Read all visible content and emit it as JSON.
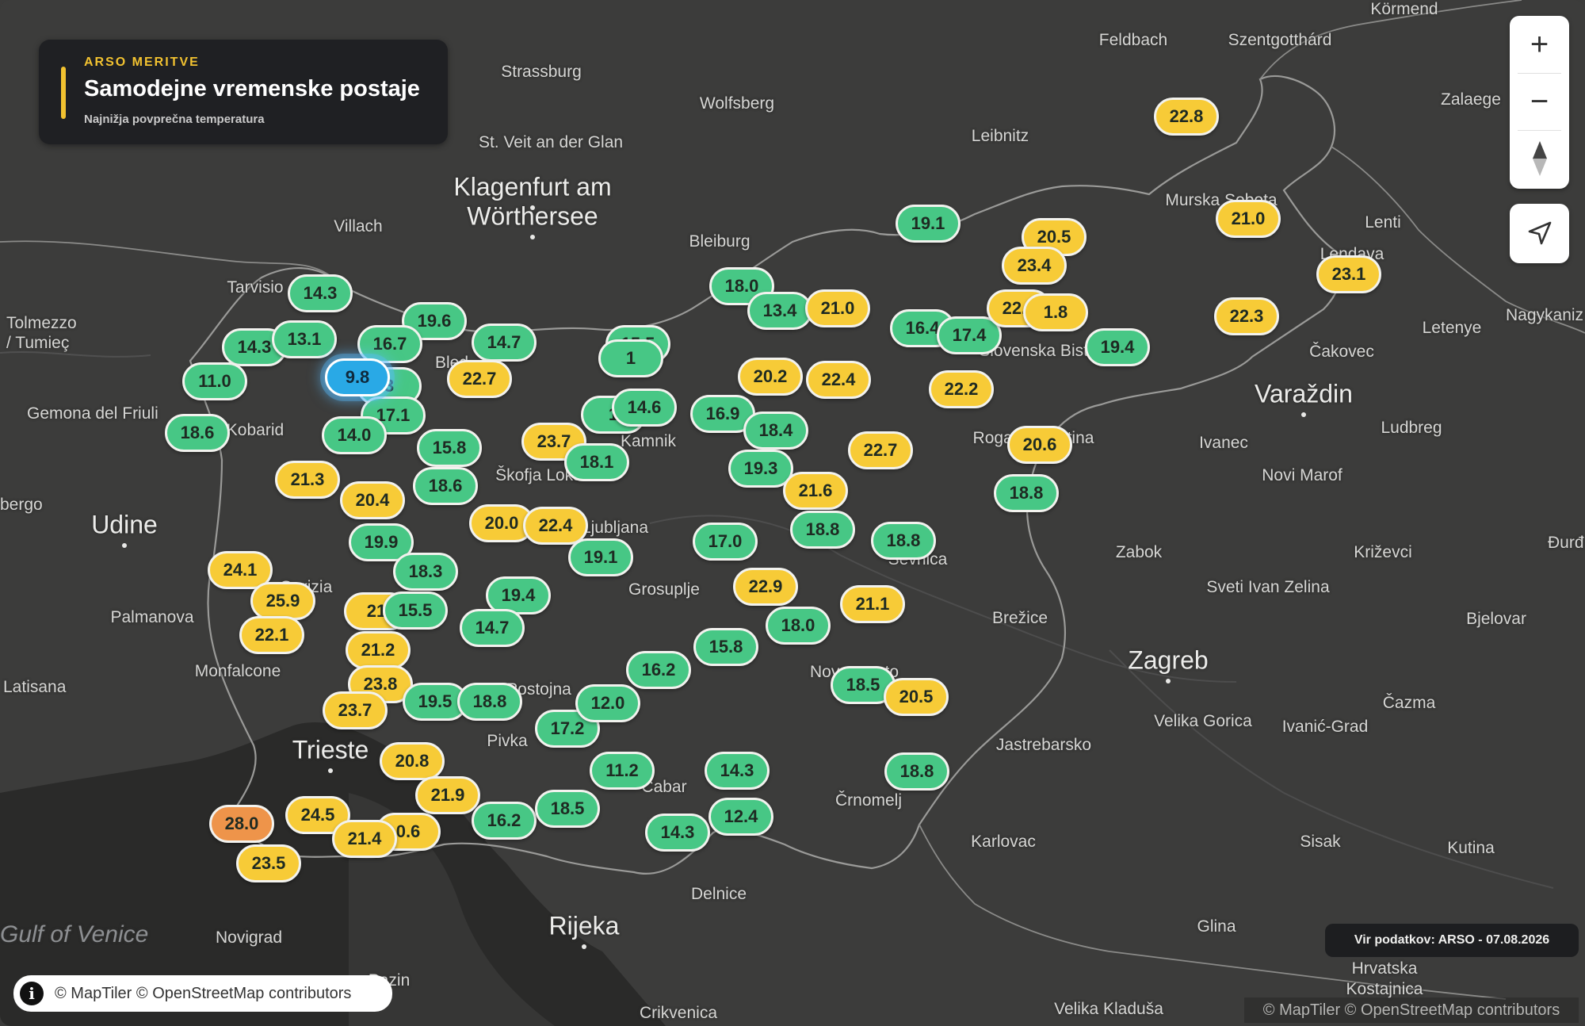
{
  "header": {
    "kicker": "ARSO MERITVE",
    "title": "Samodejne vremenske postaje",
    "subtitle": "Najnižja povprečna temperatura",
    "accent": "#f2c230"
  },
  "controls": {
    "zoom_in": "+",
    "zoom_out": "−",
    "compass": "compass-icon",
    "locate": "locate-arrow-icon"
  },
  "attribution": {
    "info_icon": "info-icon",
    "text": "© MapTiler © OpenStreetMap contributors",
    "text_corner": "© MapTiler © OpenStreetMap contributors"
  },
  "source_label": "Vir podatkov: ARSO - 07.08.2026",
  "marker_colors": {
    "green": "#47c785",
    "yellow": "#f7cb37",
    "orange": "#ee944a",
    "blue_min": "#29a9e6"
  },
  "markers": [
    {
      "value": "14.3",
      "color": "g"
    },
    {
      "value": "14.3",
      "color": "g"
    },
    {
      "value": "13.1",
      "color": "g"
    },
    {
      "value": "19.6",
      "color": "g"
    },
    {
      "value": "16.7",
      "color": "g"
    },
    {
      "value": "11.0",
      "color": "g"
    },
    {
      "value": "3",
      "color": "g"
    },
    {
      "value": "17.1",
      "color": "g"
    },
    {
      "value": "9.8",
      "color": "b"
    },
    {
      "value": "14.7",
      "color": "g"
    },
    {
      "value": "22.7",
      "color": "y"
    },
    {
      "value": "18.6",
      "color": "g"
    },
    {
      "value": "14.0",
      "color": "g"
    },
    {
      "value": "15.8",
      "color": "g"
    },
    {
      "value": "18.6",
      "color": "g"
    },
    {
      "value": "21.3",
      "color": "y"
    },
    {
      "value": "20.4",
      "color": "y"
    },
    {
      "value": "19.9",
      "color": "g"
    },
    {
      "value": "24.1",
      "color": "y"
    },
    {
      "value": "18.3",
      "color": "g"
    },
    {
      "value": "25.9",
      "color": "y"
    },
    {
      "value": "22.1",
      "color": "y"
    },
    {
      "value": "21",
      "color": "y"
    },
    {
      "value": "15.5",
      "color": "g"
    },
    {
      "value": "21.2",
      "color": "y"
    },
    {
      "value": "23.8",
      "color": "y"
    },
    {
      "value": "23.7",
      "color": "y"
    },
    {
      "value": "19.5",
      "color": "g"
    },
    {
      "value": "18.8",
      "color": "g"
    },
    {
      "value": "20.8",
      "color": "y"
    },
    {
      "value": "21.9",
      "color": "y"
    },
    {
      "value": "24.5",
      "color": "y"
    },
    {
      "value": "28.0",
      "color": "o"
    },
    {
      "value": "0.6",
      "color": "y"
    },
    {
      "value": "21.4",
      "color": "y"
    },
    {
      "value": "23.5",
      "color": "y"
    },
    {
      "value": "16.2",
      "color": "g"
    },
    {
      "value": "18.5",
      "color": "g"
    },
    {
      "value": "11.2",
      "color": "g"
    },
    {
      "value": "14.3",
      "color": "g"
    },
    {
      "value": "14.3",
      "color": "g"
    },
    {
      "value": "12.4",
      "color": "g"
    },
    {
      "value": "17.2",
      "color": "g"
    },
    {
      "value": "12.0",
      "color": "g"
    },
    {
      "value": "16.2",
      "color": "g"
    },
    {
      "value": "15.8",
      "color": "g"
    },
    {
      "value": "19.4",
      "color": "g"
    },
    {
      "value": "14.7",
      "color": "g"
    },
    {
      "value": "20.0",
      "color": "y"
    },
    {
      "value": "22.4",
      "color": "y"
    },
    {
      "value": "19.1",
      "color": "g"
    },
    {
      "value": "23.7",
      "color": "y"
    },
    {
      "value": "18.1",
      "color": "g"
    },
    {
      "value": "1",
      "color": "g"
    },
    {
      "value": "15.5",
      "color": "g"
    },
    {
      "value": "1",
      "color": "g"
    },
    {
      "value": "14.6",
      "color": "g"
    },
    {
      "value": "18.0",
      "color": "g"
    },
    {
      "value": "13.4",
      "color": "g"
    },
    {
      "value": "21.0",
      "color": "y"
    },
    {
      "value": "16.9",
      "color": "g"
    },
    {
      "value": "18.4",
      "color": "g"
    },
    {
      "value": "20.2",
      "color": "y"
    },
    {
      "value": "22.4",
      "color": "y"
    },
    {
      "value": "19.3",
      "color": "g"
    },
    {
      "value": "21.6",
      "color": "y"
    },
    {
      "value": "18.8",
      "color": "g"
    },
    {
      "value": "22.7",
      "color": "y"
    },
    {
      "value": "18.8",
      "color": "g"
    },
    {
      "value": "17.0",
      "color": "g"
    },
    {
      "value": "22.9",
      "color": "y"
    },
    {
      "value": "18.0",
      "color": "g"
    },
    {
      "value": "21.1",
      "color": "y"
    },
    {
      "value": "18.5",
      "color": "g"
    },
    {
      "value": "20.5",
      "color": "y"
    },
    {
      "value": "18.8",
      "color": "g"
    },
    {
      "value": "19.1",
      "color": "g"
    },
    {
      "value": "16.4",
      "color": "g"
    },
    {
      "value": "17.4",
      "color": "g"
    },
    {
      "value": "22.7",
      "color": "y"
    },
    {
      "value": "1.8",
      "color": "y"
    },
    {
      "value": "19.4",
      "color": "g"
    },
    {
      "value": "22.2",
      "color": "y"
    },
    {
      "value": "20.6",
      "color": "y"
    },
    {
      "value": "18.8",
      "color": "g"
    },
    {
      "value": "20.5",
      "color": "y"
    },
    {
      "value": "23.4",
      "color": "y"
    },
    {
      "value": "22.8",
      "color": "y"
    },
    {
      "value": "21.0",
      "color": "y"
    },
    {
      "value": "23.1",
      "color": "y"
    },
    {
      "value": "22.3",
      "color": "y"
    }
  ],
  "places": [
    {
      "name": "Körmend"
    },
    {
      "name": "Feldbach"
    },
    {
      "name": "Szentgotthárd"
    },
    {
      "name": "Zalaege"
    },
    {
      "name": "Strassburg"
    },
    {
      "name": "Wolfsberg"
    },
    {
      "name": "Leibnitz"
    },
    {
      "name": "St. Veit an der Glan"
    },
    {
      "name": "Klagenfurt am"
    },
    {
      "name": "Wörthersee"
    },
    {
      "name": "Villach"
    },
    {
      "name": "Bleiburg"
    },
    {
      "name": "Tarvisio"
    },
    {
      "name": "Tolmezzo"
    },
    {
      "name": "/ Tumieç"
    },
    {
      "name": "Murska Sobota"
    },
    {
      "name": "Lenti"
    },
    {
      "name": "Lendava"
    },
    {
      "name": "Nagykaniz"
    },
    {
      "name": "Letenye"
    },
    {
      "name": "Čakovec"
    },
    {
      "name": "Varaždin"
    },
    {
      "name": "Gemona del Friuli"
    },
    {
      "name": "Kobarid"
    },
    {
      "name": "Kamnik"
    },
    {
      "name": "Škofja Loka"
    },
    {
      "name": "Ljubljana"
    },
    {
      "name": "Bled"
    },
    {
      "name": "Slovenska Bistrica"
    },
    {
      "name": "Rogaška Slatina"
    },
    {
      "name": "Ivanec"
    },
    {
      "name": "Ludbreg"
    },
    {
      "name": "Novi Marof"
    },
    {
      "name": "bergo"
    },
    {
      "name": "Udine"
    },
    {
      "name": "Gorizia"
    },
    {
      "name": "Palmanova"
    },
    {
      "name": "Grosuplje"
    },
    {
      "name": "Sevnica"
    },
    {
      "name": "Zabok"
    },
    {
      "name": "Križevci"
    },
    {
      "name": "Đurđ"
    },
    {
      "name": "Sveti Ivan Zelina"
    },
    {
      "name": "Brežice"
    },
    {
      "name": "Bjelovar"
    },
    {
      "name": "Zagreb"
    },
    {
      "name": "Monfalcone"
    },
    {
      "name": "Latisana"
    },
    {
      "name": "Novo mesto"
    },
    {
      "name": "Čazma"
    },
    {
      "name": "Velika Gorica"
    },
    {
      "name": "Ivanić-Grad"
    },
    {
      "name": "Trieste"
    },
    {
      "name": "Jastrebarsko"
    },
    {
      "name": "Postojna"
    },
    {
      "name": "Pivka"
    },
    {
      "name": "Cabar"
    },
    {
      "name": "Črnomelj"
    },
    {
      "name": "Karlovac"
    },
    {
      "name": "Sisak"
    },
    {
      "name": "Kutina"
    },
    {
      "name": "Delnice"
    },
    {
      "name": "Gulf of Venice"
    },
    {
      "name": "Rijeka"
    },
    {
      "name": "Glina"
    },
    {
      "name": "Novigrad"
    },
    {
      "name": "Pazin"
    },
    {
      "name": "Hrvatska"
    },
    {
      "name": "Kostajnica"
    },
    {
      "name": "Crikvenica"
    },
    {
      "name": "Velika Kladuša"
    }
  ]
}
